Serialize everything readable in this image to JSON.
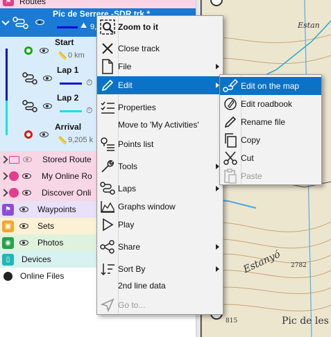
{
  "tree": {
    "routes_label": "Routes",
    "track_title": "Pic de Serrere -SDR.trk *",
    "track_sub": "9,",
    "points": [
      {
        "title": "Start",
        "sub": "0 km"
      },
      {
        "title": "Lap 1",
        "sub": ""
      },
      {
        "title": "Lap 2",
        "sub": ""
      },
      {
        "title": "Arrival",
        "sub": "9,205 k"
      }
    ],
    "folders": [
      {
        "label": "Stored Route"
      },
      {
        "label": "My Online Ro"
      },
      {
        "label": "Discover Onli"
      }
    ],
    "categories": [
      {
        "label": "Waypoints",
        "color": "#8a4fd6"
      },
      {
        "label": "Sets",
        "color": "#f0a92a"
      },
      {
        "label": "Photos",
        "color": "#27a24a"
      },
      {
        "label": "Devices",
        "color": "#24b5b5"
      },
      {
        "label": "Online Files",
        "color": "#222222"
      }
    ]
  },
  "context_menu": {
    "items": [
      {
        "label": "Zoom to it",
        "icon": "zoom-icon",
        "bold": true
      },
      {
        "label": "Close track",
        "icon": "close-icon"
      },
      {
        "label": "File",
        "icon": "file-icon",
        "submenu": true
      },
      {
        "label": "Edit",
        "icon": "pencil-icon",
        "submenu": true,
        "highlight": true
      },
      {
        "label": "Properties",
        "icon": "properties-icon"
      },
      {
        "label": "Move to 'My Activities'",
        "icon": ""
      },
      {
        "label": "Points list",
        "icon": "points-list-icon"
      },
      {
        "label": "Tools",
        "icon": "wrench-icon",
        "submenu": true
      },
      {
        "label": "Laps",
        "icon": "laps-icon",
        "submenu": true
      },
      {
        "label": "Graphs window",
        "icon": "graph-icon"
      },
      {
        "label": "Play",
        "icon": "play-icon"
      },
      {
        "label": "Share",
        "icon": "share-icon",
        "submenu": true
      },
      {
        "label": "Sort By",
        "icon": "sort-icon",
        "submenu": true
      },
      {
        "label": "2nd line data",
        "icon": ""
      },
      {
        "label": "Go to...",
        "icon": "navigate-icon",
        "disabled": true
      }
    ]
  },
  "edit_submenu": {
    "items": [
      {
        "label": "Edit on the map",
        "icon": "edit-map-icon",
        "highlight": true
      },
      {
        "label": "Edit roadbook",
        "icon": "roadbook-icon"
      },
      {
        "label": "Rename file",
        "icon": "pencil-icon"
      },
      {
        "label": "Copy",
        "icon": "copy-icon"
      },
      {
        "label": "Cut",
        "icon": "scissors-icon"
      },
      {
        "label": "Paste",
        "icon": "paste-icon",
        "disabled": true
      }
    ]
  },
  "map": {
    "labels": [
      "Estan",
      "Estanyó",
      "2782",
      "Pic de les",
      "815"
    ]
  },
  "colors": {
    "highlight": "#0a73c8",
    "selected_row": "#1a7ad4",
    "route_pink": "#f9d6e6",
    "track_light": "#d9ecfb",
    "lap1_line": "#0a0ad8",
    "lap2_line": "#16e0e8"
  }
}
